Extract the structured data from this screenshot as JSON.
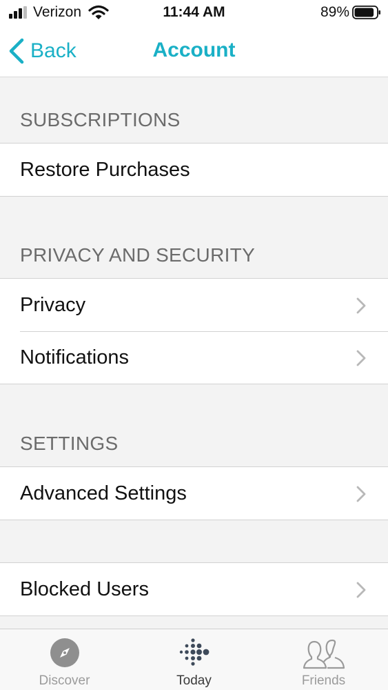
{
  "status_bar": {
    "carrier": "Verizon",
    "time": "11:44 AM",
    "battery_percent": "89%",
    "battery_level": 0.89,
    "signal_bars": 3,
    "signal_icon": "signal-bars-icon",
    "wifi_icon": "wifi-icon",
    "battery_icon": "battery-icon"
  },
  "nav": {
    "back_label": "Back",
    "back_icon": "chevron-left-icon",
    "title": "Account"
  },
  "sections": [
    {
      "header": "SUBSCRIPTIONS",
      "items": [
        {
          "label": "Restore Purchases",
          "has_chevron": false
        }
      ]
    },
    {
      "header": "PRIVACY AND SECURITY",
      "items": [
        {
          "label": "Privacy",
          "has_chevron": true
        },
        {
          "label": "Notifications",
          "has_chevron": true
        }
      ]
    },
    {
      "header": "SETTINGS",
      "items": [
        {
          "label": "Advanced Settings",
          "has_chevron": true
        }
      ]
    },
    {
      "header": "",
      "items": [
        {
          "label": "Blocked Users",
          "has_chevron": true
        }
      ]
    }
  ],
  "tab_bar": {
    "tabs": [
      {
        "label": "Discover",
        "icon": "compass-icon",
        "active": false
      },
      {
        "label": "Today",
        "icon": "fitbit-logo-icon",
        "active": true
      },
      {
        "label": "Friends",
        "icon": "friends-icon",
        "active": false
      }
    ]
  },
  "colors": {
    "accent": "#1ab0c6",
    "background": "#f3f3f3",
    "row_background": "#ffffff",
    "section_header_text": "#6b6b6b",
    "chevron": "#b8b8b8"
  }
}
